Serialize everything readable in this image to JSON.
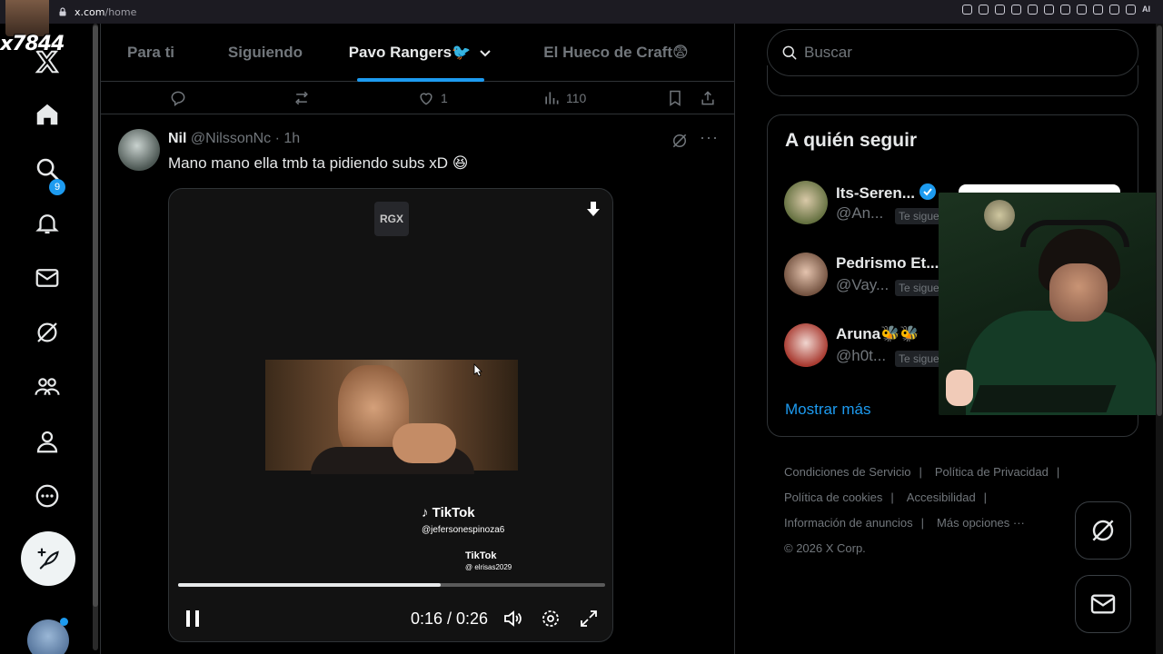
{
  "browser": {
    "url_host": "x.com",
    "url_path": "/home",
    "ext_ai_label": "AI"
  },
  "overlay": {
    "tag": "x7844"
  },
  "nav": {
    "notifications_count": "9"
  },
  "tabs": [
    {
      "label": "Para ti",
      "active": false
    },
    {
      "label": "Siguiendo",
      "active": false
    },
    {
      "label": "Pavo Rangers🐦",
      "active": true
    },
    {
      "label": "El Hueco de Craft😨",
      "active": false
    }
  ],
  "prev_tweet_actions": {
    "likes": "1",
    "views": "110"
  },
  "tweet": {
    "name": "Nil",
    "handle": "@NilssonNc",
    "time": " · 1h",
    "text": "Mano mano ella tmb ta pidiendo subs xD 😆"
  },
  "video": {
    "logo": "RGX",
    "watermark1_brand": "TikTok",
    "watermark1_handle": "@jefersonespinoza6",
    "watermark2_brand": "TikTok",
    "watermark2_handle": "@ elrisas2029",
    "time": "0:16 / 0:26",
    "progress": 0.615
  },
  "search": {
    "placeholder": "Buscar"
  },
  "who_to_follow": {
    "title": "A quién seguir",
    "users": [
      {
        "name": "Its-Seren...",
        "handle": "@An...",
        "follows_you": "Te sigue",
        "verified": true
      },
      {
        "name": "Pedrismo Et...",
        "handle": "@Vay...",
        "follows_you": "Te sigue",
        "verified": false
      },
      {
        "name": "Aruna🐝🐝",
        "handle": "@h0t...",
        "follows_you": "Te sigue",
        "verified": false
      }
    ],
    "show_more": "Mostrar más"
  },
  "footer": {
    "terms": "Condiciones de Servicio",
    "privacy": "Política de Privacidad",
    "cookies": "Política de cookies",
    "accessibility": "Accesibilidad",
    "ads_info": "Información de anuncios",
    "more": "Más opciones ···",
    "copyright": "© 2026 X Corp."
  },
  "colors": {
    "accent": "#1d9bf0",
    "bg": "#000000",
    "text": "#e7e9ea",
    "muted": "#71767b",
    "border": "#2f3336"
  }
}
